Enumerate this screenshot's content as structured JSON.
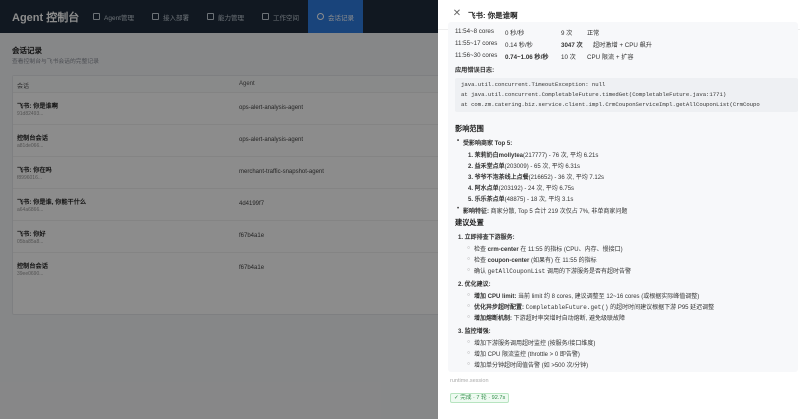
{
  "app": {
    "brand": "Agent 控制台",
    "nav": [
      {
        "label": "Agent管理",
        "icon": "grid-icon"
      },
      {
        "label": "接入部署",
        "icon": "plug-icon"
      },
      {
        "label": "能力管理",
        "icon": "box-icon"
      },
      {
        "label": "工作空间",
        "icon": "folder-icon"
      },
      {
        "label": "会话记录",
        "icon": "chat-icon",
        "active": true
      }
    ]
  },
  "page": {
    "title": "会话记录",
    "subtitle": "查看控制台与飞书会话的完整记录",
    "columns": [
      "会话",
      "Agent"
    ],
    "rows": [
      {
        "title": "飞书: 你是谁啊",
        "id": "91d82493...",
        "agent": "ops-alert-analysis-agent"
      },
      {
        "title": "控制台会话",
        "id": "a81de066...",
        "agent": "ops-alert-analysis-agent"
      },
      {
        "title": "飞书: 你在吗",
        "id": "f8996016...",
        "agent": "merchant-traffic-snapshot-agent"
      },
      {
        "title": "飞书: 你是谁, 你能干什么",
        "id": "a64a6866...",
        "agent": "4d4199f7"
      },
      {
        "title": "飞书: 你好",
        "id": "05ba85a8...",
        "agent": "f67b4a1e"
      },
      {
        "title": "控制台会话",
        "id": "39ee0690...",
        "agent": "f67b4a1e"
      }
    ]
  },
  "drawer": {
    "title": "飞书: 你是谁啊",
    "metrics": [
      {
        "time": "11:54~8 cores",
        "rate": "0 秒/秒",
        "count": "9 次",
        "desc": "正常"
      },
      {
        "time": "11:55~17 cores",
        "rate": "0.14 秒/秒",
        "count": "3047 次",
        "desc": "超时激增 + CPU 飙升"
      },
      {
        "time": "11:56~30 cores",
        "rate": "0.74~1.06 秒/秒",
        "count": "10 次",
        "desc": "CPU 限流 + 扩容"
      }
    ],
    "log_heading": "应用错误日志:",
    "log_lines": [
      "java.util.concurrent.TimeoutException: null",
      "  at java.util.concurrent.CompletableFuture.timedGet(CompletableFuture.java:1771)",
      "  at com.zm.catering.biz.service.client.impl.CrmCouponServiceImpl.getAllCouponList(CrmCoupo"
    ],
    "impact_heading": "影响范围",
    "top5_label": "受影响商家 Top 5:",
    "top5": [
      {
        "name": "1. 茉莉奶白mollytea",
        "info": "(217777) - 76 次, 平均 6.21s"
      },
      {
        "name": "2. 益禾堂点单",
        "info": "(203009) - 65 次, 平均 6.31s"
      },
      {
        "name": "3. 爷爷不泡茶线上点餐",
        "info": "(216652) - 36 次, 平均 7.12s"
      },
      {
        "name": "4. 阿水点单",
        "info": "(203192) - 24 次, 平均 6.75s"
      },
      {
        "name": "5. 乐乐茶点单",
        "info": "(48875) - 18 次, 平均 3.1s"
      }
    ],
    "feature_label": "影响特征:",
    "feature_text": "商家分散, Top 5 合计 219 次仅占 7%, 非单商家问题",
    "advice_heading": "建议处置",
    "advice": [
      {
        "title": "1. 立即排查下游服务:",
        "items": [
          {
            "prefix": "检查 ",
            "bold": "crm-center",
            "rest": " 在 11:55 的指标 (CPU、内存、慢接口)"
          },
          {
            "prefix": "检查 ",
            "bold": "coupon-center",
            "rest": " (如果有) 在 11:55 的指标"
          },
          {
            "prefix": "确认 ",
            "code": "getAllCouponList",
            "rest": " 调用的下游服务是否有超时告警"
          }
        ]
      },
      {
        "title": "2. 优化建议:",
        "items": [
          {
            "prefix": "",
            "bold": "增加 CPU limit:",
            "rest": " 当前 limit 约 8 cores, 建议调整至 12~16 cores (或根据实际峰值调整)"
          },
          {
            "prefix": "",
            "bold": "优化异步超时配置:",
            "code": "CompletableFuture.get()",
            "rest": " 的超时时间建议根据下游 P95 延迟调整"
          },
          {
            "prefix": "",
            "bold": "增加熔断机制:",
            "rest": " 下游超时率突增时自动熔断, 避免级联故障"
          }
        ]
      },
      {
        "title": "3. 监控增强:",
        "items": [
          {
            "prefix": "增加下游服务调用超时监控 (按服务/接口维度)",
            "rest": ""
          },
          {
            "prefix": "增加 CPU 限流监控 (throttle > 0 即告警)",
            "rest": ""
          },
          {
            "prefix": "增加单分钟超时阈值告警 (如 >500 次/分钟)",
            "rest": ""
          }
        ]
      }
    ],
    "runtime_label": "runtime.session",
    "status": "✓ 完成 · 7 轮 · 92.7s"
  }
}
